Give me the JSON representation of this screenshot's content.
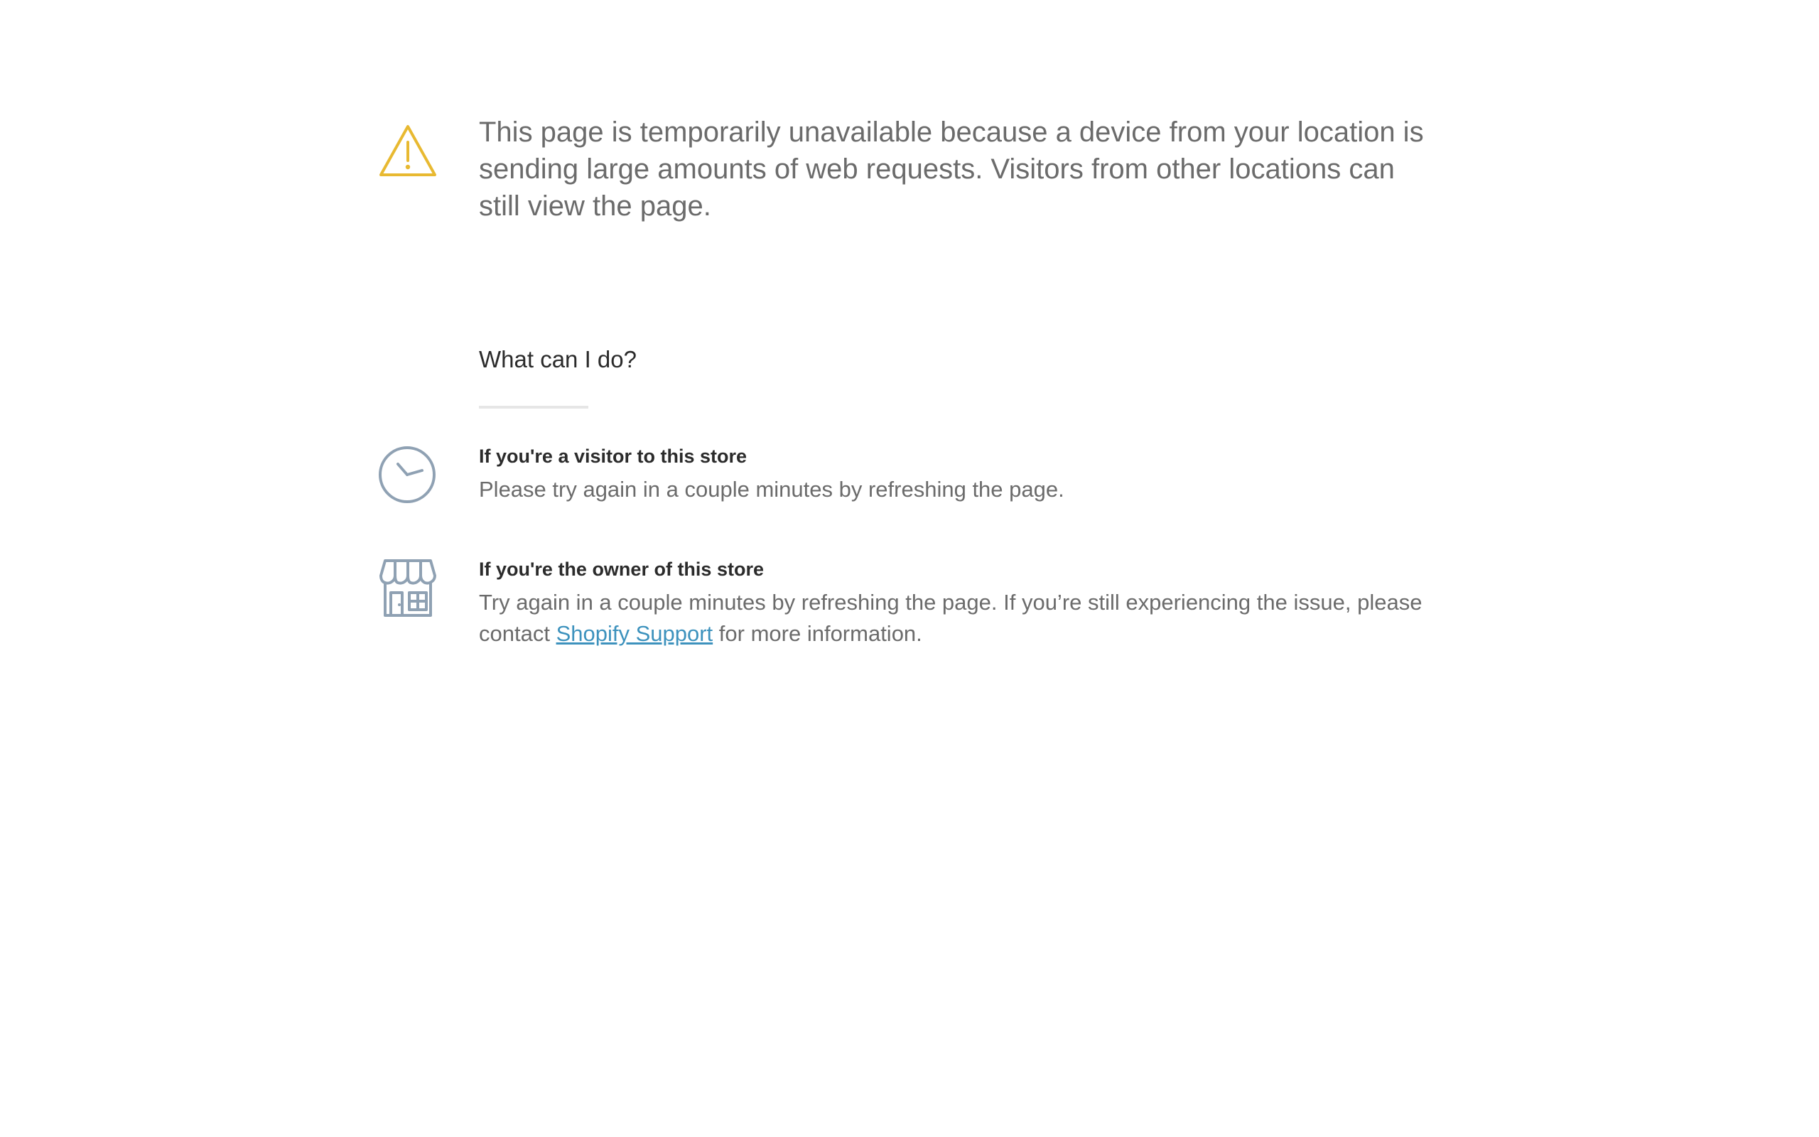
{
  "alert": {
    "message": "This page is temporarily unavailable because a device from your location is sending large amounts of web requests. Visitors from other locations can still view the page.",
    "icon": "warning-icon",
    "icon_color": "#e8b931"
  },
  "help": {
    "title": "What can I do?",
    "items": [
      {
        "icon": "clock-icon",
        "heading": "If you're a visitor to this store",
        "body": "Please try again in a couple minutes by refreshing the page."
      },
      {
        "icon": "storefront-icon",
        "heading": "If you're the owner of this store",
        "body_before": "Try again in a couple minutes by refreshing the page. If you’re still experiencing the issue, please contact",
        "link_text": "Shopify Support",
        "body_after": "for more information."
      }
    ]
  },
  "colors": {
    "icon_gray": "#8fa1b3",
    "link": "#3d92bd",
    "text_muted": "#6b6b6b",
    "text_dark": "#2b2b2b"
  }
}
